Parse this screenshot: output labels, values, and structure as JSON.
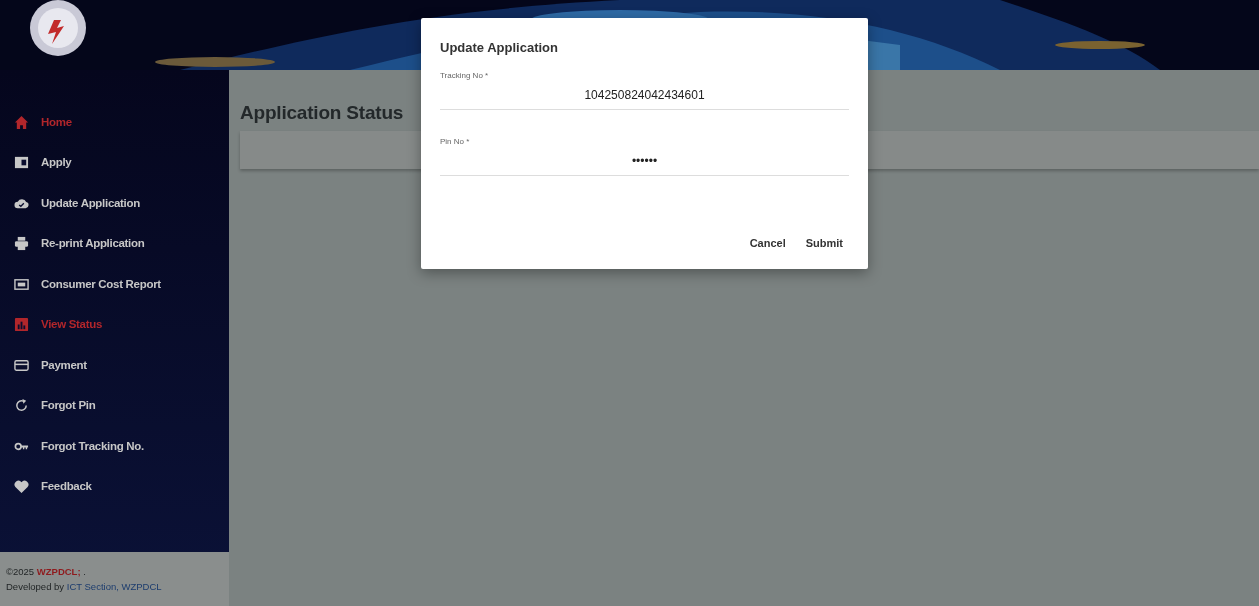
{
  "sidebar": {
    "items": [
      {
        "label": "Home",
        "selected": true
      },
      {
        "label": "Apply",
        "selected": false
      },
      {
        "label": "Update Application",
        "selected": false
      },
      {
        "label": "Re-print Application",
        "selected": false
      },
      {
        "label": "Consumer Cost Report",
        "selected": false
      },
      {
        "label": "View Status",
        "selected": true
      },
      {
        "label": "Payment",
        "selected": false
      },
      {
        "label": "Forgot Pin",
        "selected": false
      },
      {
        "label": "Forgot Tracking No.",
        "selected": false
      },
      {
        "label": "Feedback",
        "selected": false
      }
    ],
    "footer": {
      "year": "©2025",
      "brand": "WZPDCL;",
      "suffix": ".",
      "developed_by": "Developed by",
      "developer_link": "ICT Section, WZPDCL"
    }
  },
  "main": {
    "title": "Application Status"
  },
  "dialog": {
    "title": "Update Application",
    "fields": [
      {
        "label": "Tracking No *",
        "value": "104250824042434601"
      },
      {
        "label": "Pin No *",
        "value": "••••••"
      }
    ],
    "buttons": [
      "Cancel",
      "Submit"
    ]
  }
}
